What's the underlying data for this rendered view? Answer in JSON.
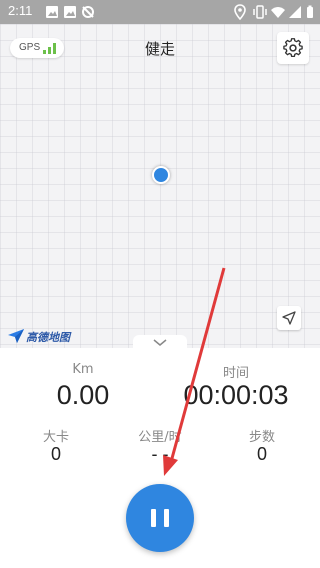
{
  "status_bar": {
    "time": "2:11",
    "left_icons": [
      "image-icon",
      "image-icon",
      "no-signal-icon"
    ],
    "right_icons": [
      "location-icon",
      "vibrate-icon",
      "wifi-icon",
      "signal-icon",
      "battery-icon"
    ]
  },
  "header": {
    "gps_label": "GPS",
    "gps_signal_color": "#6cc04a",
    "title": "健走",
    "settings_icon": "gear-icon"
  },
  "map": {
    "logo_text": "高德地图",
    "locate_icon": "navigation-arrow-icon",
    "location_dot_color": "#2f86e0"
  },
  "stats": {
    "distance": {
      "label": "Km",
      "value": "0.00"
    },
    "time": {
      "label": "时间",
      "value": "00:00:03"
    },
    "calories": {
      "label": "大卡",
      "value": "0"
    },
    "speed": {
      "label": "公里/时",
      "value": "- -"
    },
    "steps": {
      "label": "步数",
      "value": "0"
    }
  },
  "controls": {
    "pause_icon": "pause-icon",
    "accent": "#2f86e0"
  },
  "annotation": {
    "arrow_color": "#e03a3a"
  }
}
